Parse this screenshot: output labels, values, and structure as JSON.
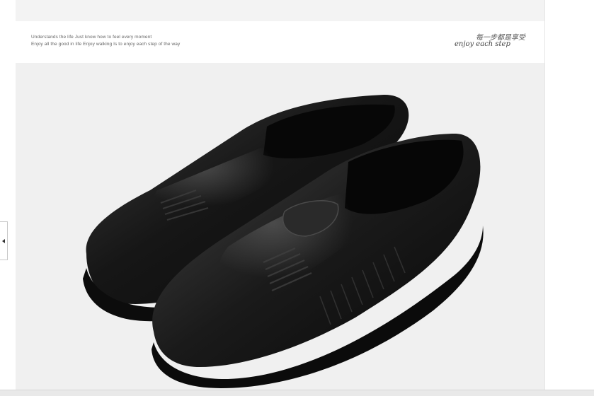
{
  "header": {
    "tagline_line1": "Understands the life  Just know how to feel every moment",
    "tagline_line2": "Enjoy all the good in life   Enjoy walking   Is to enjoy each step of the way",
    "signature_cn": "每一步都是享受",
    "signature_en": "enjoy each step"
  },
  "product": {
    "image_name": "black-leather-slip-on-shoes"
  },
  "nav": {
    "prev_icon": "chevron-left-icon"
  },
  "colors": {
    "background": "#f0f0f0",
    "shoe": "#141414",
    "accent_text": "#666666"
  }
}
